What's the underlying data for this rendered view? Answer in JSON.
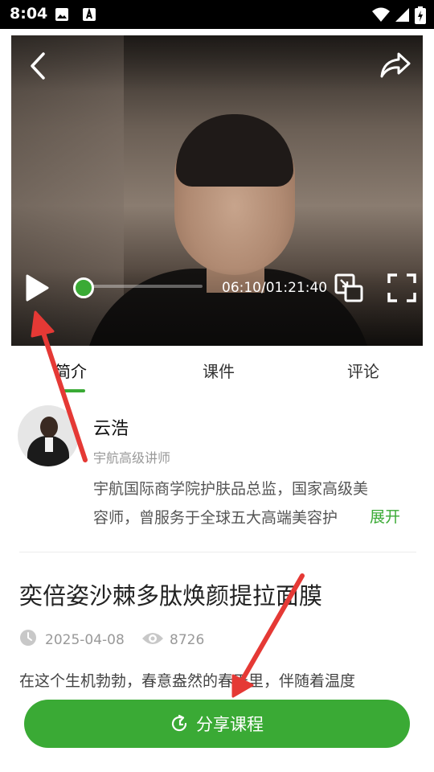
{
  "status_bar": {
    "time": "8:04",
    "icons": [
      "image-icon",
      "font-download-icon",
      "wifi-icon",
      "signal-icon",
      "battery-charging-icon"
    ]
  },
  "video": {
    "back_icon": "back-icon",
    "share_icon": "share-arrow-icon",
    "play_icon": "play-icon",
    "pip_icon": "picture-in-picture-icon",
    "fullscreen_icon": "fullscreen-icon",
    "time": "06:10/01:21:40",
    "progress_fraction": 0.075
  },
  "tabs": [
    {
      "label": "简介",
      "active": true
    },
    {
      "label": "课件",
      "active": false
    },
    {
      "label": "评论",
      "active": false
    }
  ],
  "teacher": {
    "name": "云浩",
    "title": "宇航高级讲师",
    "bio_line1": "宇航国际商学院护肤品总监，国家高级美",
    "bio_line2": "容师，曾服务于全球五大高端美容护",
    "expand": "展开"
  },
  "course": {
    "title": "奕倍姿沙棘多肽焕颜提拉面膜",
    "date": "2025-04-08",
    "views": "8726",
    "description": "在这个生机勃勃，春意盎然的春天里，伴随着温度"
  },
  "share_button": {
    "label": "分享课程",
    "icon": "share-course-icon"
  },
  "colors": {
    "accent": "#3aaa35",
    "annotation_arrow": "#e53935"
  }
}
